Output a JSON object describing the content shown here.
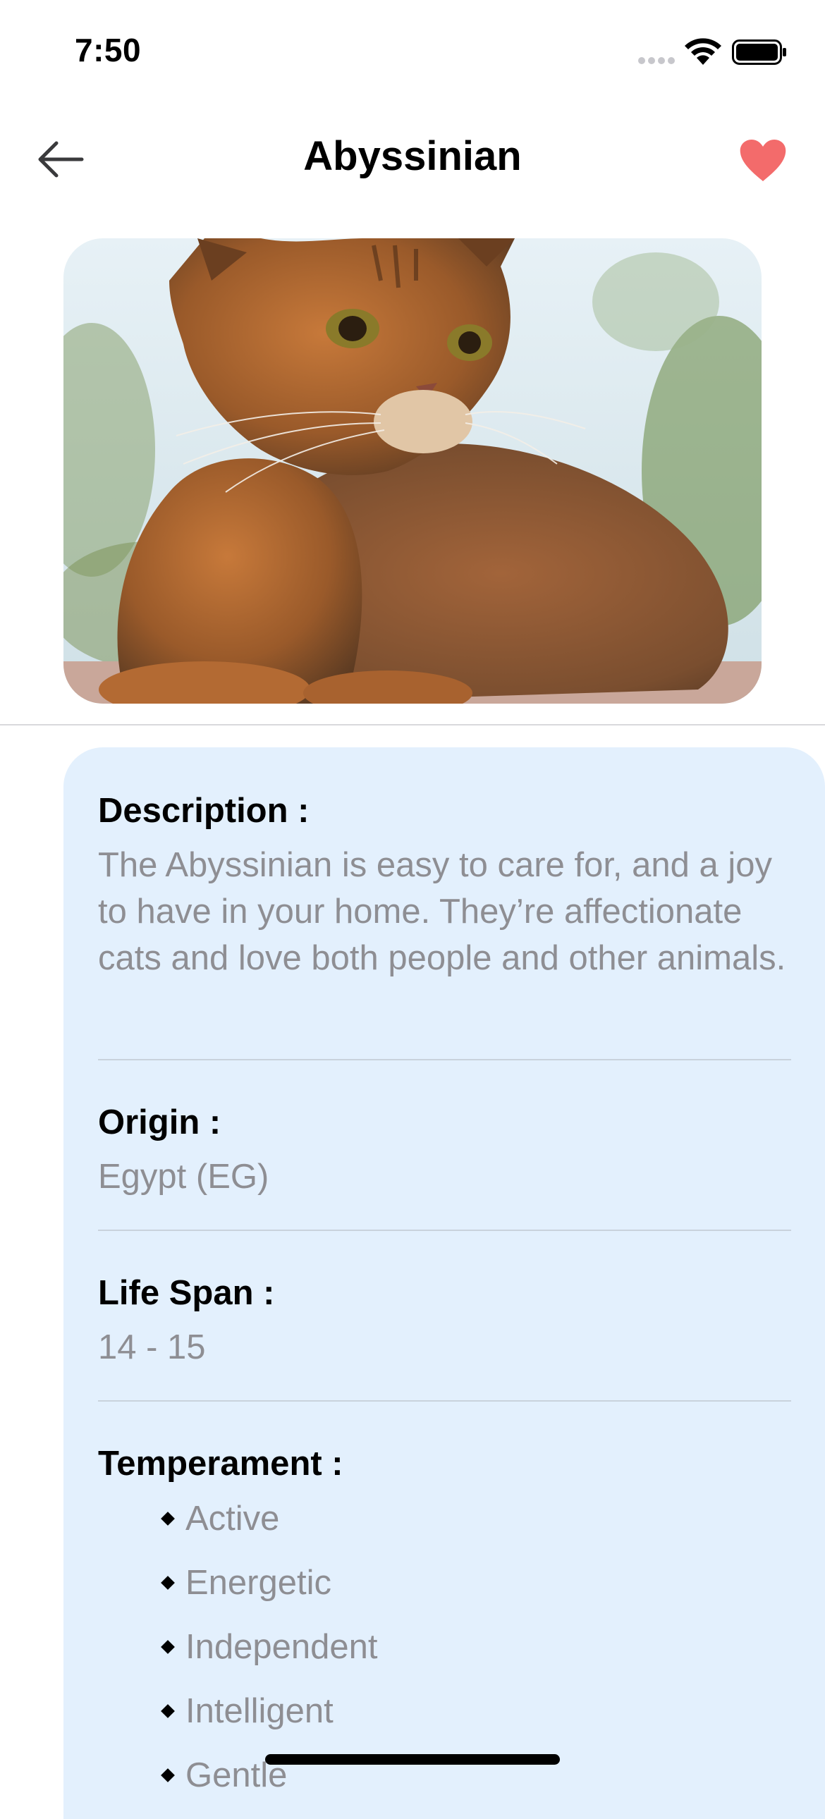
{
  "status_bar": {
    "time": "7:50",
    "icons": [
      "cellular-signal-icon",
      "wifi-icon",
      "battery-icon"
    ]
  },
  "nav": {
    "back_icon": "arrow-left-icon",
    "title": "Abyssinian",
    "favorite_icon": "heart-icon",
    "favorite_color": "#f36b6b"
  },
  "hero": {
    "subject": "cat-photo"
  },
  "details": {
    "description": {
      "label": "Description :",
      "value": "The Abyssinian is easy to care for, and a joy to have in your home. They’re affectionate cats and love both people and other animals."
    },
    "origin": {
      "label": "Origin :",
      "value": "Egypt (EG)"
    },
    "life_span": {
      "label": "Life Span :",
      "value": "14 - 15"
    },
    "temperament": {
      "label": "Temperament :",
      "items": [
        "Active",
        "Energetic",
        "Independent",
        "Intelligent",
        "Gentle"
      ]
    }
  },
  "colors": {
    "card_background": "#e3f0fd",
    "secondary_text": "#8e8e93",
    "accent_heart": "#f36b6b"
  }
}
